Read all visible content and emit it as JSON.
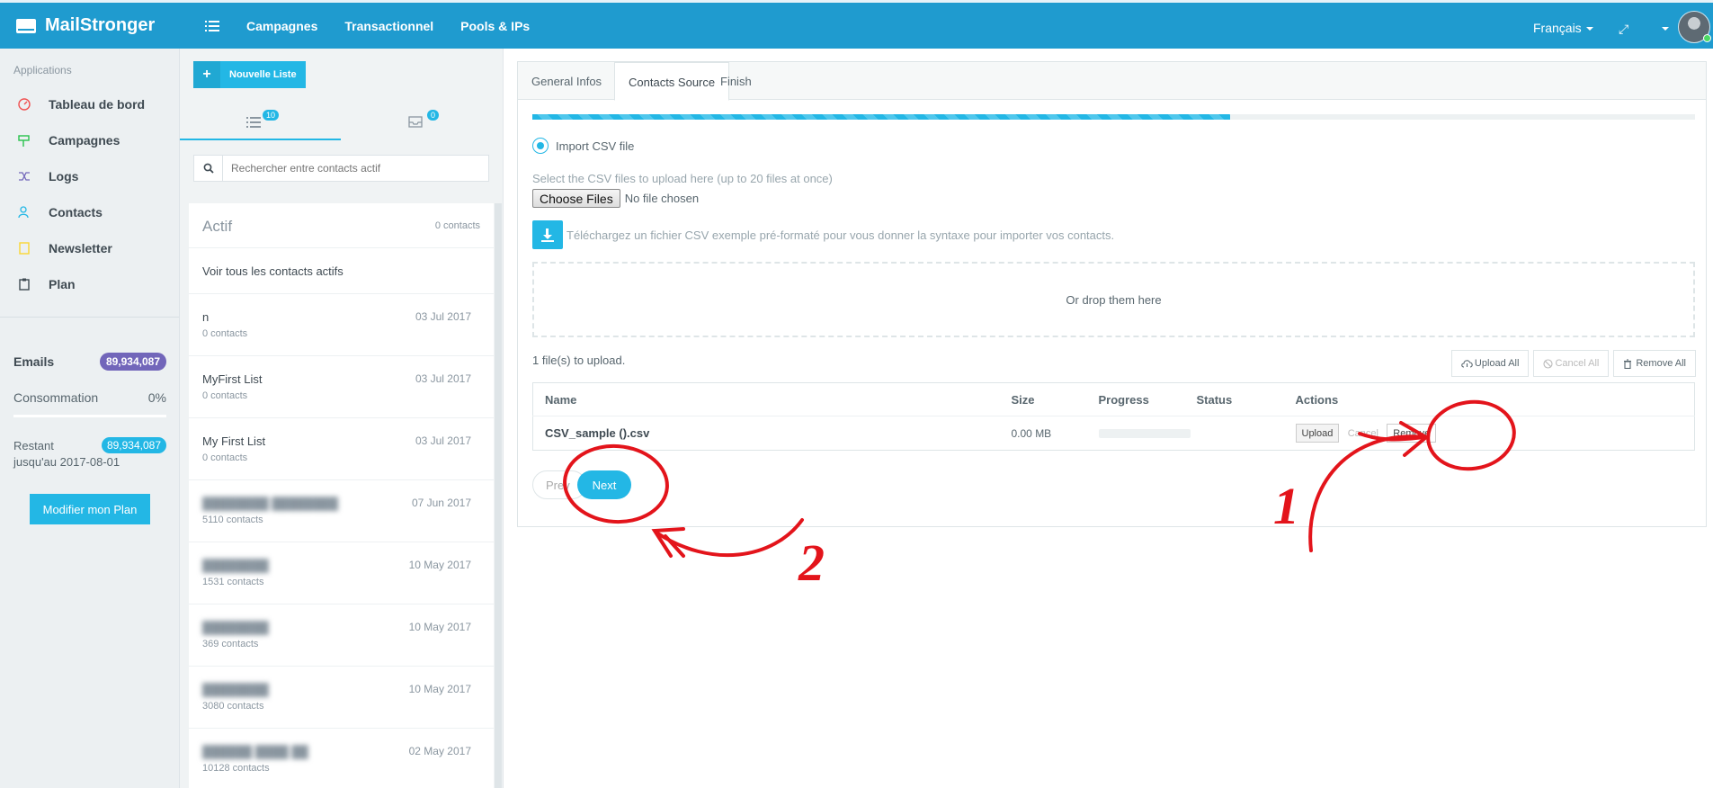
{
  "app": {
    "brand": "MailStronger"
  },
  "topnav": {
    "items": [
      "Campagnes",
      "Transactionnel",
      "Pools & IPs"
    ],
    "language": "Français"
  },
  "sidebar": {
    "heading": "Applications",
    "items": [
      {
        "label": "Tableau de bord",
        "icon": "gauge-icon",
        "color": "#f05050"
      },
      {
        "label": "Campagnes",
        "icon": "signpost-icon",
        "color": "#27c24c"
      },
      {
        "label": "Logs",
        "icon": "shuffle-icon",
        "color": "#7266ba"
      },
      {
        "label": "Contacts",
        "icon": "contacts-icon",
        "color": "#23b7e5"
      },
      {
        "label": "Newsletter",
        "icon": "document-icon",
        "color": "#fad733"
      },
      {
        "label": "Plan",
        "icon": "clipboard-icon",
        "color": "#3f4a52"
      }
    ],
    "emails_label": "Emails",
    "emails_value": "89,934,087",
    "consumption_label": "Consommation",
    "consumption_value": "0%",
    "remaining_label": "Restant",
    "remaining_value": "89,934,087",
    "until": "jusqu'au 2017-08-01",
    "plan_button": "Modifier mon Plan"
  },
  "lists_panel": {
    "new_button": "Nouvelle Liste",
    "tab_lists_count": "10",
    "tab_inbox_count": "0",
    "search_placeholder": "Rechercher entre contacts actif",
    "card_title": "Actif",
    "card_count": "0 contacts",
    "see_all": "Voir tous les contacts actifs",
    "rows": [
      {
        "name": "n",
        "count": "0 contacts",
        "date": "03 Jul 2017",
        "blurred": false
      },
      {
        "name": "MyFirst List",
        "count": "0 contacts",
        "date": "03 Jul 2017",
        "blurred": false
      },
      {
        "name": "My First List",
        "count": "0 contacts",
        "date": "03 Jul 2017",
        "blurred": false
      },
      {
        "name": "",
        "count": "5110 contacts",
        "date": "07 Jun 2017",
        "blurred": true
      },
      {
        "name": "",
        "count": "1531 contacts",
        "date": "10 May 2017",
        "blurred": true
      },
      {
        "name": "",
        "count": "369 contacts",
        "date": "10 May 2017",
        "blurred": true
      },
      {
        "name": "",
        "count": "3080 contacts",
        "date": "10 May 2017",
        "blurred": true
      },
      {
        "name": "",
        "count": "10128 contacts",
        "date": "02 May 2017",
        "blurred": true
      }
    ]
  },
  "wizard": {
    "tabs": [
      "General Infos",
      "Contacts Source",
      "Finish"
    ],
    "active_tab": "Contacts Source",
    "progress_percent": 60,
    "radio_label": "Import CSV file",
    "help_text": "Select the CSV files to upload here (up to 20 files at once)",
    "choose_button": "Choose Files",
    "no_file": "No file chosen",
    "download_text": "Téléchargez un fichier CSV exemple pré-formaté pour vous donner la syntaxe pour importer vos contacts.",
    "dropzone": "Or drop them here",
    "files_to_upload": "1 file(s) to upload.",
    "bulk": {
      "upload_all": "Upload All",
      "cancel_all": "Cancel All",
      "remove_all": "Remove All"
    },
    "table": {
      "headers": [
        "Name",
        "Size",
        "Progress",
        "Status",
        "Actions"
      ],
      "row": {
        "name": "CSV_sample ().csv",
        "size": "0.00 MB",
        "progress": 0,
        "status": ""
      },
      "actions": {
        "upload": "Upload",
        "cancel": "Cancel",
        "remove": "Remove"
      }
    },
    "prev": "Prev",
    "next": "Next"
  },
  "annotations": {
    "one": "1",
    "two": "2",
    "color": "#e3141b"
  }
}
